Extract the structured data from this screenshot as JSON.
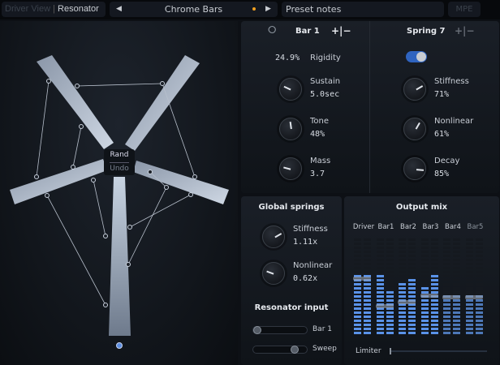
{
  "topbar": {
    "view_tab": "Driver View",
    "resonator_tab": "Resonator",
    "preset_name": "Chrome Bars",
    "prev": "◀",
    "next": "▶",
    "notes": "Preset notes",
    "mpe": "MPE",
    "modified_dot_color": "#f0a020"
  },
  "center": {
    "rand": "Rand",
    "undo": "Undo"
  },
  "bar_panel": {
    "title": "Bar 1",
    "add_remove": "+|−",
    "rigidity_value": "24.9%",
    "rigidity_label": "Rigidity",
    "knobs": [
      {
        "label": "Sustain",
        "value": "5.0sec",
        "angle": -65
      },
      {
        "label": "Tone",
        "value": "48%",
        "angle": -8
      },
      {
        "label": "Mass",
        "value": "3.7",
        "angle": -75
      }
    ]
  },
  "spring_panel": {
    "title": "Spring 7",
    "add_remove": "+|−",
    "enabled": true,
    "knobs": [
      {
        "label": "Stiffness",
        "value": "71%",
        "angle": 60
      },
      {
        "label": "Nonlinear",
        "value": "61%",
        "angle": 30
      },
      {
        "label": "Decay",
        "value": "85%",
        "angle": 95
      }
    ]
  },
  "global_springs": {
    "title": "Global springs",
    "knobs": [
      {
        "label": "Stiffness",
        "value": "1.11x",
        "angle": 60
      },
      {
        "label": "Nonlinear",
        "value": "0.62x",
        "angle": -70
      }
    ]
  },
  "resonator_input": {
    "title": "Resonator input",
    "sliders": [
      {
        "label": "Bar 1",
        "value": 0
      },
      {
        "label": "Sweep",
        "value": 0.8
      }
    ]
  },
  "output_mix": {
    "title": "Output mix",
    "limiter_label": "Limiter",
    "limiter_value": 0,
    "channels": [
      {
        "name": "Driver",
        "levels": [
          0.66,
          0.66
        ],
        "fader": 0.58
      },
      {
        "name": "Bar1",
        "levels": [
          0.64,
          0.48
        ],
        "fader": 0.3
      },
      {
        "name": "Bar2",
        "levels": [
          0.56,
          0.62
        ],
        "fader": 0.34
      },
      {
        "name": "Bar3",
        "levels": [
          0.52,
          0.66
        ],
        "fader": 0.41
      },
      {
        "name": "Bar4",
        "levels": [
          0.45,
          0.44
        ],
        "fader": 0.39
      },
      {
        "name": "Bar5",
        "levels": [
          0.45,
          0.43
        ],
        "fader": 0.39
      }
    ]
  }
}
